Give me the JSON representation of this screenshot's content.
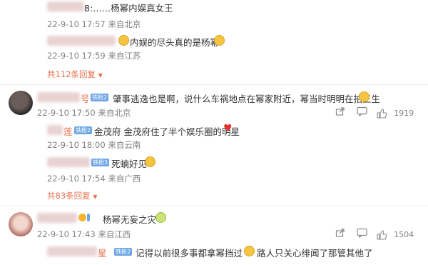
{
  "comments": [
    {
      "replies": [
        {
          "text": "8:……杨幂内娱真女王",
          "time": "22-9-10 17:57 来自北京"
        },
        {
          "text": "内娱的尽头真的是杨幂",
          "time": "22-9-10 17:59 来自江苏"
        }
      ],
      "more_label": "共112条回复"
    },
    {
      "user_suffix": "号",
      "badge": "铁粉2",
      "text": "肇事逃逸也是啊，说什么车祸地点在幂家附近，幂当时明明在拍三生",
      "time": "22-9-10 17:50 来自北京",
      "like_count": "1919",
      "replies": [
        {
          "user_suffix": "莲",
          "badge": "铁粉2",
          "text": "金茂府 金茂府住了半个娱乐圈的明星",
          "time": "22-9-10 18:00 来自云南"
        },
        {
          "badge": "铁粉3",
          "text": "死蝻好见",
          "time": "22-9-10 17:54 来自广西"
        }
      ],
      "more_label": "共83条回复"
    },
    {
      "text": "杨幂无妄之灾",
      "time": "22-9-10 17:43 来自江西",
      "like_count": "1504",
      "replies": [
        {
          "user_suffix": "星",
          "badge": "铁粉2",
          "text_a": "记得以前很多事都拿幂挡过",
          "text_b": "路人只关心绯闻了那管其他了"
        }
      ]
    }
  ]
}
